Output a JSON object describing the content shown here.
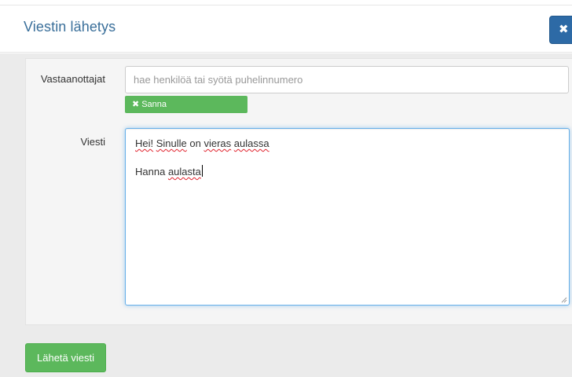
{
  "modal": {
    "title": "Viestin lähetys",
    "close_icon": "close-icon",
    "close_glyph": "✖"
  },
  "form": {
    "recipients": {
      "label": "Vastaanottajat",
      "placeholder": "hae henkilöä tai syötä puhelinnumero",
      "value": "",
      "tags": [
        {
          "label": "Sanna",
          "remove_icon": "remove-icon",
          "remove_glyph": "✖"
        }
      ]
    },
    "message": {
      "label": "Viesti",
      "lines": [
        {
          "words": [
            "Hei!",
            " ",
            "Sinulle",
            " on ",
            "vieras",
            " ",
            "aulassa"
          ]
        },
        {
          "words": []
        },
        {
          "words": [
            "Hanna",
            " ",
            "aulasta"
          ]
        }
      ]
    },
    "send_button": {
      "label": "Lähetä viesti"
    }
  },
  "colors": {
    "title": "#3a6f9a",
    "close_button": "#2d6aa6",
    "tag_green": "#5cb85c",
    "focus_border": "#66afe9",
    "spellcheck_underline": "#e0202a"
  }
}
